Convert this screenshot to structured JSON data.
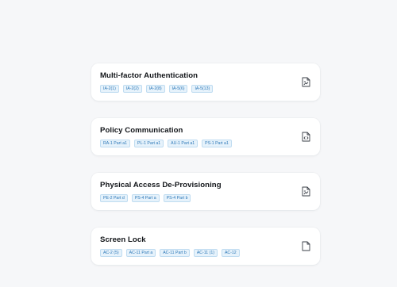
{
  "cards": [
    {
      "title": "Multi-factor Authentication",
      "icon": "file-signature-icon",
      "tags": [
        "IA-2(1)",
        "IA-2(2)",
        "IA-2(8)",
        "IA-5(6)",
        "IA-5(13)"
      ]
    },
    {
      "title": "Policy Communication",
      "icon": "file-code-icon",
      "tags": [
        "RA-1 Part a1",
        "PL-1 Part a1",
        "AU-1 Part a1",
        "PS-1 Part a1"
      ]
    },
    {
      "title": "Physical Access De-Provisioning",
      "icon": "file-signature-icon",
      "tags": [
        "PE-2 Part d",
        "PS-4 Part a",
        "PS-4 Part b"
      ]
    },
    {
      "title": "Screen Lock",
      "icon": "file-icon",
      "tags": [
        "AC-2 (5)",
        "AC-11 Part a",
        "AC-11 Part b",
        "AC-11 (1)",
        "AC-12"
      ]
    }
  ]
}
